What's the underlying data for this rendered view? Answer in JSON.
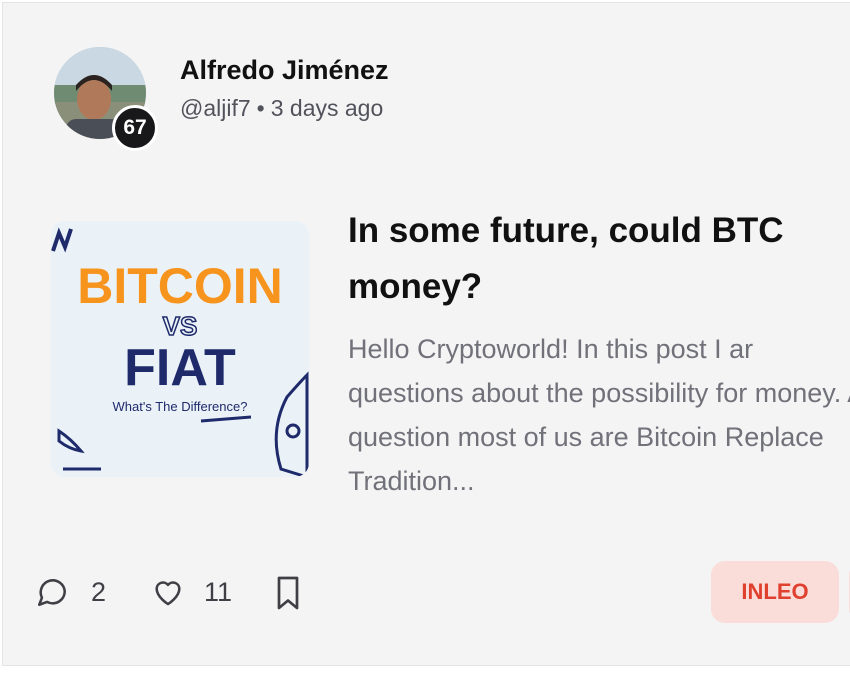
{
  "author": {
    "name": "Alfredo Jiménez",
    "handle": "@aljif7",
    "separator": "•",
    "posted": "3 days ago",
    "reputation": "67"
  },
  "post": {
    "title": "In some future, could BTC money?",
    "excerpt": "Hello Cryptoworld! In this post I ar questions about the possibility for money. A question most of us are Bitcoin Replace Tradition...",
    "thumbnail": {
      "line1": "BITCOIN",
      "line2": "VS",
      "line3": "FIAT",
      "line4": "What's The Difference?"
    }
  },
  "actions": {
    "comments_count": "2",
    "likes_count": "11",
    "comment_icon": "comment-bubble-icon",
    "like_icon": "heart-icon",
    "bookmark_icon": "bookmark-icon"
  },
  "tags": [
    {
      "label": "INLEO"
    }
  ],
  "colors": {
    "card_bg": "#f4f4f5",
    "tag_bg": "#fadcd9",
    "tag_text": "#e0412e",
    "thumb_orange": "#f7941d",
    "thumb_navy": "#1f2a6b"
  }
}
